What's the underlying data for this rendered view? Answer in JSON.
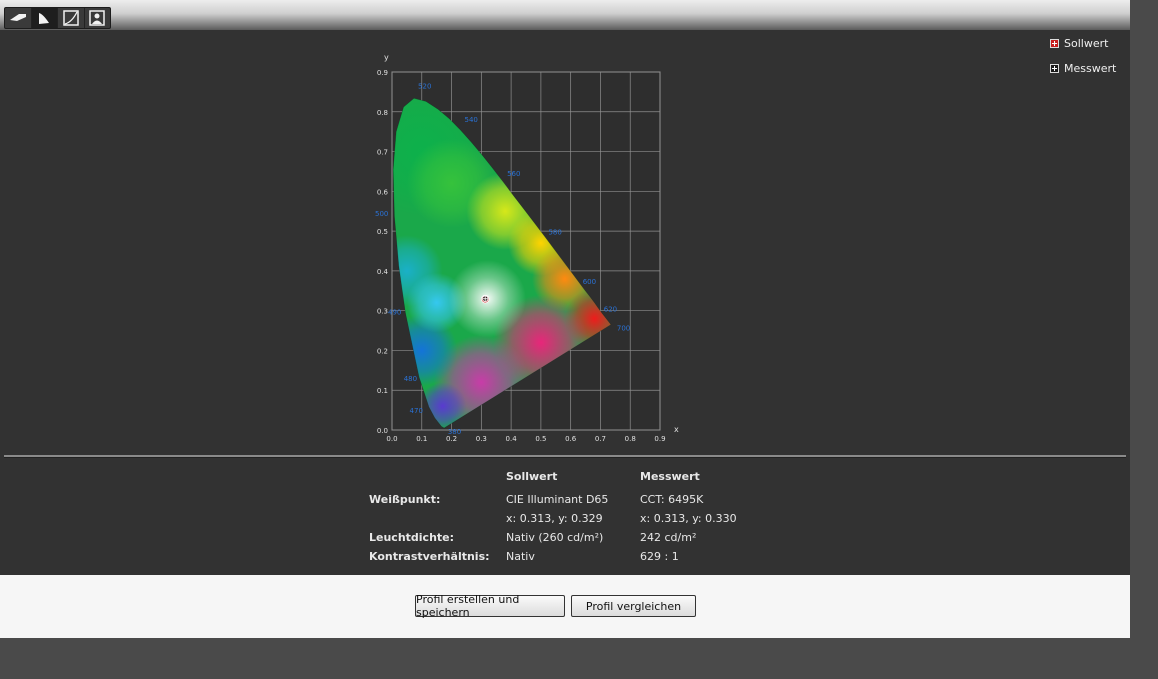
{
  "toolbar": {
    "buttons": [
      {
        "icon": "display-icon",
        "active": false
      },
      {
        "icon": "gamut-icon",
        "active": true
      },
      {
        "icon": "curve-icon",
        "active": false
      },
      {
        "icon": "person-icon",
        "active": false
      }
    ]
  },
  "legend": {
    "target_label": "Sollwert",
    "measured_label": "Messwert"
  },
  "chart_data": {
    "type": "scatter",
    "xlabel": "x",
    "ylabel": "y",
    "xlim": [
      0,
      0.9
    ],
    "ylim": [
      0,
      0.9
    ],
    "xticks": [
      "0.0",
      "0.1",
      "0.2",
      "0.3",
      "0.4",
      "0.5",
      "0.6",
      "0.7",
      "0.8",
      "0.9"
    ],
    "yticks": [
      "0.0",
      "0.1",
      "0.2",
      "0.3",
      "0.4",
      "0.5",
      "0.6",
      "0.7",
      "0.8",
      "0.9"
    ],
    "grid": true,
    "wavelength_labels": [
      {
        "text": "520",
        "x": 0.074,
        "y": 0.834
      },
      {
        "text": "540",
        "x": 0.23,
        "y": 0.754
      },
      {
        "text": "560",
        "x": 0.373,
        "y": 0.624
      },
      {
        "text": "580",
        "x": 0.512,
        "y": 0.487
      },
      {
        "text": "600",
        "x": 0.627,
        "y": 0.372
      },
      {
        "text": "620",
        "x": 0.691,
        "y": 0.308
      },
      {
        "text": "700",
        "x": 0.735,
        "y": 0.265
      },
      {
        "text": "500",
        "x": 0.008,
        "y": 0.538
      },
      {
        "text": "490",
        "x": 0.045,
        "y": 0.295
      },
      {
        "text": "480",
        "x": 0.091,
        "y": 0.133
      },
      {
        "text": "470",
        "x": 0.124,
        "y": 0.058
      },
      {
        "text": "380",
        "x": 0.174,
        "y": 0.005
      }
    ],
    "series": [
      {
        "name": "Sollwert",
        "x": [
          0.313
        ],
        "y": [
          0.329
        ],
        "color": "#c81e1e"
      },
      {
        "name": "Messwert",
        "x": [
          0.313
        ],
        "y": [
          0.33
        ],
        "color": "#1a1a1a"
      }
    ]
  },
  "results": {
    "col_target": "Sollwert",
    "col_measured": "Messwert",
    "rows": [
      {
        "label": "Weißpunkt:",
        "target": "CIE Illuminant D65",
        "measured": "CCT: 6495K"
      },
      {
        "label": "",
        "target": "x: 0.313, y: 0.329",
        "measured": "x: 0.313, y: 0.330"
      },
      {
        "label": "Leuchtdichte:",
        "target": "Nativ (260 cd/m²)",
        "measured": "242 cd/m²"
      },
      {
        "label": "Kontrastverhältnis:",
        "target": "Nativ",
        "measured": "629 : 1"
      }
    ]
  },
  "buttons": {
    "create_profile": "Profil erstellen und speichern",
    "compare_profile": "Profil vergleichen"
  },
  "colors": {
    "panel": "#323232",
    "axis_label": "#2a72d6",
    "button_area": "#f6f6f6"
  }
}
